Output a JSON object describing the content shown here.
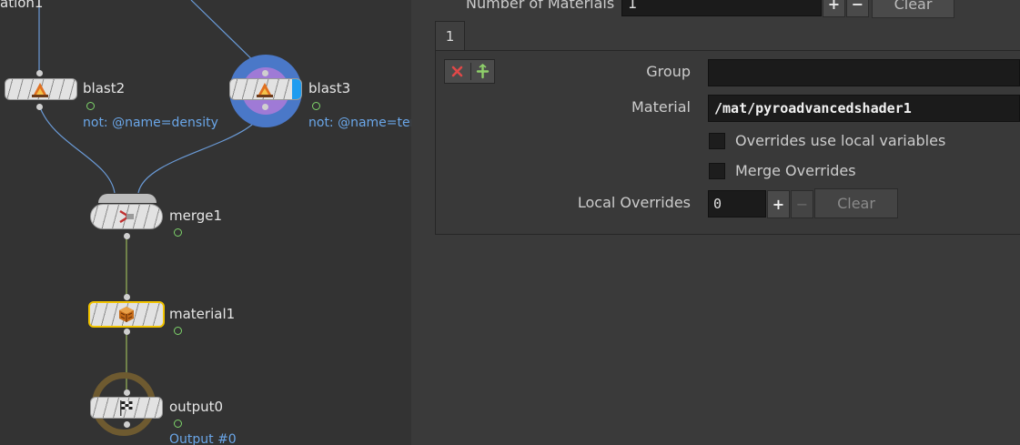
{
  "network": {
    "nodes": {
      "top_partial": {
        "label": "ation1"
      },
      "blast2": {
        "label": "blast2",
        "comment": "not: @name=density"
      },
      "blast3": {
        "label": "blast3",
        "comment": "not: @name=tem"
      },
      "merge1": {
        "label": "merge1"
      },
      "material1": {
        "label": "material1"
      },
      "output0": {
        "label": "output0",
        "comment": "Output #0"
      }
    }
  },
  "params": {
    "num_materials": {
      "label": "Number of Materials",
      "value": "1",
      "add": "+",
      "remove": "−",
      "clear": "Clear"
    },
    "tab": {
      "label": "1"
    },
    "group": {
      "label": "Group",
      "value": ""
    },
    "material": {
      "label": "Material",
      "value": "/mat/pyroadvancedshader1"
    },
    "overrides_local": {
      "label": "Overrides use local variables",
      "checked": false
    },
    "merge_overrides": {
      "label": "Merge Overrides",
      "checked": false
    },
    "local_overrides": {
      "label": "Local Overrides",
      "value": "0",
      "add": "+",
      "remove": "−",
      "clear": "Clear"
    }
  },
  "colors": {
    "network_bg": "#333333",
    "params_bg": "#3a3a3a",
    "wire_blue": "#6a9ad6",
    "wire_green": "#9ab85a",
    "comment_blue": "#6aa6e8",
    "selected_outline": "#f2c400",
    "display_flag": "#1e9cf0"
  }
}
